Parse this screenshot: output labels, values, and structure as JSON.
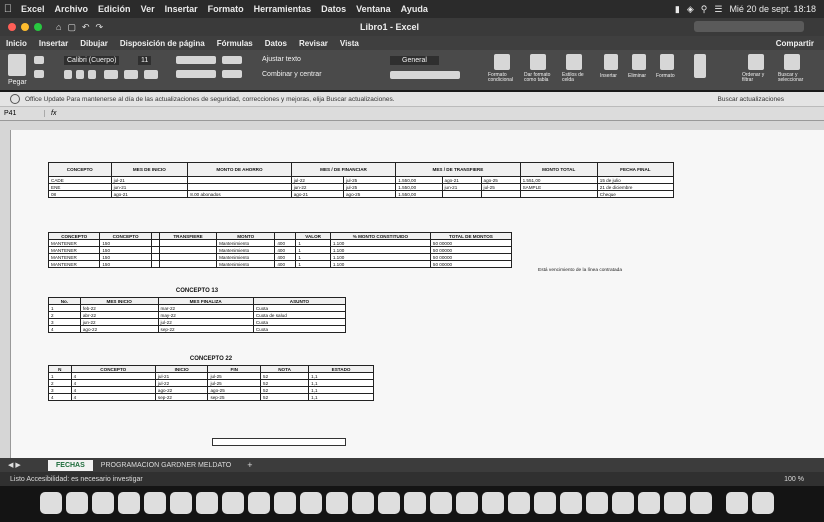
{
  "menubar": {
    "app_menus": [
      "Excel",
      "Archivo",
      "Edición",
      "Ver",
      "Insertar",
      "Formato",
      "Herramientas",
      "Datos",
      "Ventana",
      "Ayuda"
    ],
    "clock": "Mié 20 de sept. 18:18"
  },
  "window": {
    "title": "Libro1 - Excel"
  },
  "ribbon": {
    "tabs": [
      "Inicio",
      "Insertar",
      "Dibujar",
      "Disposición de página",
      "Fórmulas",
      "Datos",
      "Revisar",
      "Vista"
    ],
    "share_label": "Compartir",
    "paste_label": "Pegar",
    "font_name": "Calibri (Cuerpo)",
    "font_size": "11",
    "wrap_label": "Ajustar texto",
    "merge_label": "Combinar y centrar",
    "number_format": "General",
    "group_labels": [
      "Formato condicional",
      "Dar formato como tabla",
      "Estilos de celda",
      "Insertar",
      "Eliminar",
      "Formato",
      "Ordenar y filtrar",
      "Buscar y seleccionar"
    ]
  },
  "update_bar": {
    "message": "Office Update  Para mantenerse al día de las actualizaciones de seguridad, correcciones y mejoras, elija Buscar actualizaciones.",
    "action": "Buscar actualizaciones"
  },
  "formula_bar": {
    "name_box": "P41",
    "fx": "fx",
    "content": ""
  },
  "sheet": {
    "table1": {
      "headers": [
        "CONCEPTO",
        "MES DE INICIO",
        "MONTO DE AHORRO",
        "MES / DE FINANCIAR",
        "",
        "MES / DE TRANSFIERE",
        "",
        "MONTO TOTAL",
        "FECHA FINAL",
        ""
      ],
      "rows": [
        [
          "CADE",
          "jul-21",
          "",
          "jul-22",
          "jul-25",
          "1.550,00",
          "ago-21",
          "ago-25",
          "1.551,00",
          "15 de julio"
        ],
        [
          "ENE",
          "jun-21",
          "",
          "jun-22",
          "jul-25",
          "1.550,00",
          "jun-21",
          "jul-25",
          "SAMPLE",
          "21 de diciembre"
        ],
        [
          "08",
          "ago-21",
          "8.00 abonados",
          "ago-21",
          "ago-25",
          "1.550,00",
          "",
          "",
          "",
          "Cheque"
        ]
      ]
    },
    "table2": {
      "headers": [
        "CONCEPTO",
        "CONCEPTO",
        "",
        "TRANSFIERE",
        "MONTO",
        "",
        "VALOR",
        "% MONTO CONSTITUIDO",
        "TOTAL DE MONTOS"
      ],
      "rows": [
        [
          "MANTENER",
          "150",
          "",
          "",
          "Mantenimiento",
          "400",
          "1",
          "1.100",
          "50 00000"
        ],
        [
          "MANTENER",
          "150",
          "",
          "",
          "Mantenimiento",
          "400",
          "1",
          "1.100",
          "50 00000"
        ],
        [
          "MANTENER",
          "150",
          "",
          "",
          "Mantenimiento",
          "400",
          "1",
          "1.100",
          "50 00000"
        ],
        [
          "MANTENER",
          "150",
          "",
          "",
          "Mantenimiento",
          "400",
          "1",
          "1.100",
          "50 00000"
        ]
      ],
      "side_note": "Está vencimiento de la línea contratada"
    },
    "table3": {
      "title": "CONCEPTO 13",
      "headers": [
        "No.",
        "MES INICIO",
        "MES FINALIZA",
        "ASUNTO"
      ],
      "rows": [
        [
          "1",
          "feb-22",
          "mar-22",
          "Cuota"
        ],
        [
          "2",
          "abr-22",
          "may-22",
          "Cuota de salud"
        ],
        [
          "3",
          "jun-22",
          "jul-22",
          "Cuota"
        ],
        [
          "4",
          "ago-22",
          "sep-22",
          "Cuota"
        ]
      ]
    },
    "table4": {
      "title": "CONCEPTO 22",
      "headers": [
        "N",
        "CONCEPTO",
        "INICIO",
        "FIN",
        "NOTA",
        "ESTADO"
      ],
      "rows": [
        [
          "1",
          "4",
          "jul-21",
          "jul-25",
          "52",
          "1,1"
        ],
        [
          "2",
          "4",
          "jul-22",
          "jul-25",
          "52",
          "1,1"
        ],
        [
          "3",
          "4",
          "ago-22",
          "ago-25",
          "52",
          "1,1"
        ],
        [
          "4",
          "4",
          "sep-22",
          "sep-25",
          "52",
          "1,1"
        ]
      ]
    }
  },
  "sheet_tabs": {
    "tabs": [
      "FECHAS",
      "PROGRAMACION GARDNER MELDATO"
    ],
    "active_index": 0,
    "add_label": "+"
  },
  "status_bar": {
    "text": "Listo   Accesibilidad: es necesario investigar",
    "zoom": "100 %"
  }
}
